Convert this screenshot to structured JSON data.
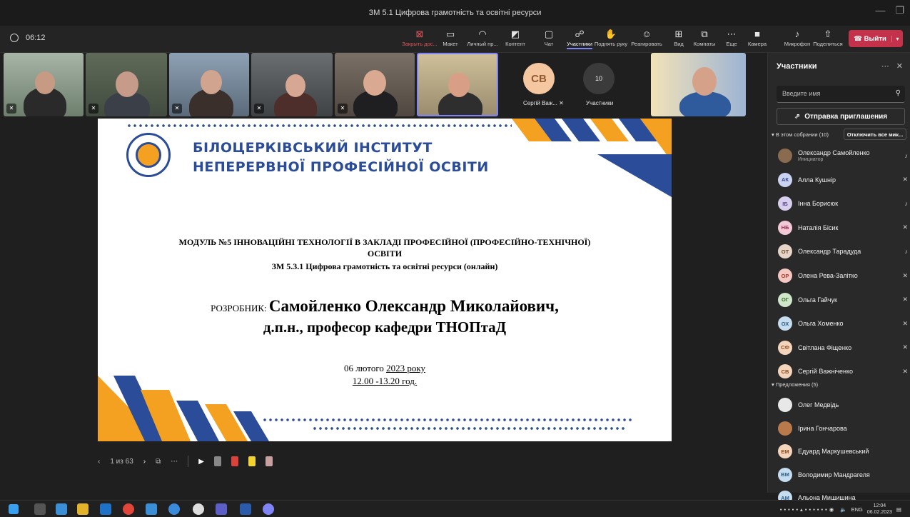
{
  "window": {
    "title": "ЗМ 5.1 Цифрова грамотність та освітні ресурси"
  },
  "toolbar": {
    "elapsed": "06:12",
    "close_content": "Закрыть дос...",
    "layout": "Макет",
    "personal": "Личный пр...",
    "content": "Контент",
    "chat": "Чат",
    "participants": "Участники",
    "raise_hand": "Поднять руку",
    "react": "Реагировать",
    "view": "Вид",
    "rooms": "Комнаты",
    "more": "Еще",
    "camera": "Камера",
    "mic": "Микрофон",
    "share": "Поделиться",
    "leave": "Выйти"
  },
  "gallery": {
    "tile_sv_initials": "CB",
    "tile_sv_name": "Сергій Важ...",
    "tile_count": "10",
    "tile_count_label": "Участники"
  },
  "slide": {
    "institute_line1": "БІЛОЦЕРКІВСЬКИЙ ІНСТИТУТ",
    "institute_line2": "НЕПЕРЕРВНОЇ ПРОФЕСІЙНОЇ ОСВІТИ",
    "module_line1": "МОДУЛЬ №5 ІННОВАЦІЙНІ ТЕХНОЛОГІЇ В ЗАКЛАДІ ПРОФЕСІЙНОЇ (ПРОФЕСІЙНО-ТЕХНІЧНОЇ)",
    "module_line2": "ОСВІТИ",
    "module_line3": "ЗМ 5.3.1 Цифрова грамотність та освітні ресурси (онлайн)",
    "developer_label": "РОЗРОБНИК: ",
    "developer_name": "Самойленко Олександр Миколайович,",
    "developer_title": "д.п.н., професор кафедри ТНОПтаД",
    "date_prefix": "06 лютого ",
    "date_year": "2023  року",
    "time": "12.00 -13.20 год."
  },
  "slide_nav": {
    "page": "1 из 63"
  },
  "panel": {
    "title": "Участники",
    "search_placeholder": "Введите имя",
    "invite": "Отправка приглашения",
    "in_meeting": "▾ В этом собрании (10)",
    "mute_all": "Отключить все мик...",
    "organizer_role": "Инициатор",
    "participants": [
      {
        "initials": "",
        "name": "Олександр Самойленко",
        "color": "#8a6b4f",
        "text_color": "#ffffff"
      },
      {
        "initials": "АК",
        "name": "Алла Кушнір",
        "color": "#c9d2f0",
        "text_color": "#3e4a86"
      },
      {
        "initials": "ІБ",
        "name": "Інна Борисюк",
        "color": "#d8cfee",
        "text_color": "#5b4a8f"
      },
      {
        "initials": "НБ",
        "name": "Наталія Бісик",
        "color": "#f4c9d6",
        "text_color": "#9b2f53"
      },
      {
        "initials": "ОТ",
        "name": "Олександр Тарадуда",
        "color": "#e6d4c6",
        "text_color": "#6f4b31"
      },
      {
        "initials": "ОР",
        "name": "Олена Рева-Залітко",
        "color": "#f4c7c1",
        "text_color": "#a13a2e"
      },
      {
        "initials": "ОГ",
        "name": "Ольга Гайчук",
        "color": "#cfe6c8",
        "text_color": "#366b2a"
      },
      {
        "initials": "ОХ",
        "name": "Ольга Хоменко",
        "color": "#c6dcef",
        "text_color": "#2f5e86"
      },
      {
        "initials": "СФ",
        "name": "Світлана Фіщенко",
        "color": "#f5d4bc",
        "text_color": "#8a4d1f"
      },
      {
        "initials": "СВ",
        "name": "Сергій Важніченко",
        "color": "#f5d4bc",
        "text_color": "#8a4d1f"
      }
    ],
    "suggestions_header": "▾ Предложения (5)",
    "suggestions": [
      {
        "initials": "",
        "name": "Олег Медвідь",
        "color": "#e8e8e8",
        "text_color": "#333333"
      },
      {
        "initials": "",
        "name": "Ірина Гончарова",
        "color": "#b87a4b",
        "text_color": "#ffffff"
      },
      {
        "initials": "ЕМ",
        "name": "Едуард Маркушевський",
        "color": "#f5d4bc",
        "text_color": "#8a4d1f"
      },
      {
        "initials": "ВМ",
        "name": "Володимир Мандрагеля",
        "color": "#c6dcef",
        "text_color": "#2f5e86"
      },
      {
        "initials": "АМ",
        "name": "Альона Мищишина",
        "color": "#c6dcef",
        "text_color": "#2f5e86"
      }
    ]
  },
  "taskbar": {
    "lang": "ENG",
    "time": "12:04",
    "date": "06.02.2023"
  }
}
